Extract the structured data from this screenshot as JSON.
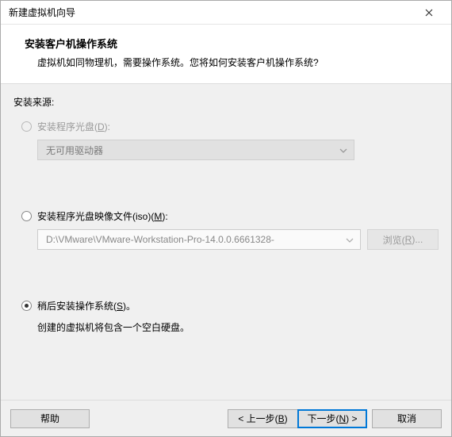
{
  "window": {
    "title": "新建虚拟机向导"
  },
  "header": {
    "title": "安装客户机操作系统",
    "description": "虚拟机如同物理机，需要操作系统。您将如何安装客户机操作系统?"
  },
  "content": {
    "source_label": "安装来源:",
    "opt_disc": {
      "label_pre": "安装程序光盘(",
      "mnemonic": "D",
      "label_post": "):"
    },
    "disc_dropdown": "无可用驱动器",
    "opt_iso": {
      "label_pre": "安装程序光盘映像文件(iso)(",
      "mnemonic": "M",
      "label_post": "):"
    },
    "iso_path": "D:\\VMware\\VMware-Workstation-Pro-14.0.0.6661328-",
    "browse": {
      "label_pre": "浏览(",
      "mnemonic": "R",
      "label_post": ")..."
    },
    "opt_later": {
      "label_pre": "稍后安装操作系统(",
      "mnemonic": "S",
      "label_post": ")。"
    },
    "later_hint": "创建的虚拟机将包含一个空白硬盘。"
  },
  "footer": {
    "help": "帮助",
    "back_pre": "< 上一步(",
    "back_m": "B",
    "back_post": ")",
    "next_pre": "下一步(",
    "next_m": "N",
    "next_post": ") >",
    "cancel": "取消"
  }
}
